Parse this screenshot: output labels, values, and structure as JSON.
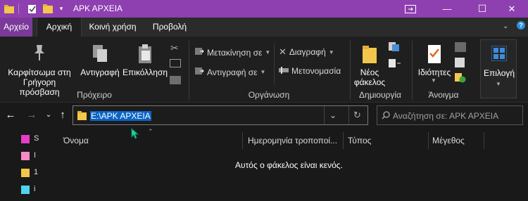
{
  "window": {
    "title": "ΑΡΚ ΑΡΧΕΙΑ",
    "controls": {
      "minimize": "—",
      "maximize": "☐",
      "close": "✕"
    }
  },
  "tabs": [
    "Αρχείο",
    "Αρχική",
    "Κοινή χρήση",
    "Προβολή"
  ],
  "ribbon": {
    "clipboard": {
      "pin_label_1": "Καρφίτσωμα στη",
      "pin_label_2": "Γρήγορη πρόσβαση",
      "copy": "Αντιγραφή",
      "paste": "Επικόλληση",
      "group": "Πρόχειρο"
    },
    "organize": {
      "move_to": "Μετακίνηση σε",
      "copy_to": "Αντιγραφή σε",
      "delete": "Διαγραφή",
      "rename": "Μετονομασία",
      "group": "Οργάνωση"
    },
    "new": {
      "new_folder_1": "Νέος",
      "new_folder_2": "φάκελος",
      "group": "Δημιουργία"
    },
    "open": {
      "properties": "Ιδιότητες",
      "group": "Άνοιγμα"
    },
    "select": {
      "label": "Επιλογή"
    }
  },
  "address": {
    "path": "E:\\ΑΡΚ ΑΡΧΕΙΑ",
    "search_placeholder": "Αναζήτηση σε: ΑΡΚ ΑΡΧΕΙΑ"
  },
  "columns": [
    "Όνομα",
    "Ημερομηνία τροποποί...",
    "Τύπος",
    "Μέγεθος"
  ],
  "empty_message": "Αυτός ο φάκελος είναι κενός.",
  "sidebar_items": [
    "S",
    "I",
    "1",
    "i"
  ],
  "colors": {
    "titlebar": "#8e3fb0",
    "file_tab": "#7b3a99",
    "selection": "#0a64c6"
  }
}
